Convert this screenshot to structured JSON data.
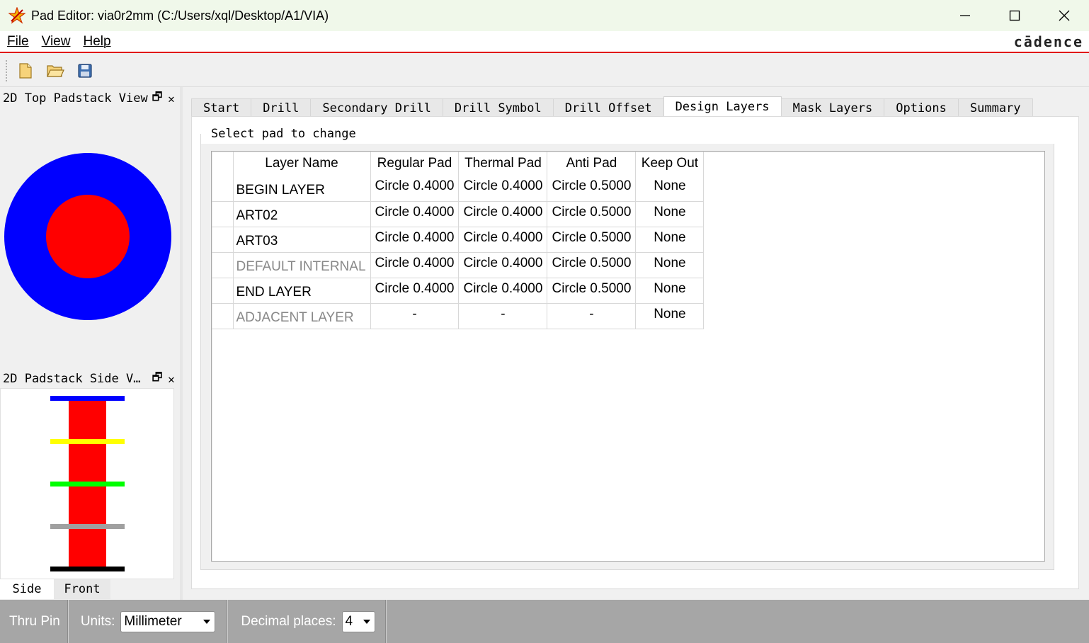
{
  "window": {
    "title": "Pad Editor: via0r2mm  (C:/Users/xql/Desktop/A1/VIA)"
  },
  "menu": {
    "items": [
      "File",
      "View",
      "Help"
    ],
    "brand": "cādence"
  },
  "toolbar": {
    "buttons": [
      "new-file-icon",
      "open-folder-icon",
      "save-icon"
    ]
  },
  "panels": {
    "top_view": {
      "title": "2D Top Padstack View"
    },
    "side_view": {
      "title": "2D Padstack Side V…"
    },
    "side_tabs": [
      "Side",
      "Front"
    ]
  },
  "tabs": [
    "Start",
    "Drill",
    "Secondary Drill",
    "Drill Symbol",
    "Drill Offset",
    "Design Layers",
    "Mask Layers",
    "Options",
    "Summary"
  ],
  "active_tab": "Design Layers",
  "group": {
    "title": "Select pad to change"
  },
  "table": {
    "headers": [
      "Layer Name",
      "Regular Pad",
      "Thermal Pad",
      "Anti Pad",
      "Keep Out"
    ],
    "rows": [
      {
        "name": "BEGIN LAYER",
        "regular": "Circle 0.4000",
        "thermal": "Circle 0.4000",
        "anti": "Circle 0.5000",
        "keepout": "None",
        "disabled": false
      },
      {
        "name": "ART02",
        "regular": "Circle 0.4000",
        "thermal": "Circle 0.4000",
        "anti": "Circle 0.5000",
        "keepout": "None",
        "disabled": false
      },
      {
        "name": "ART03",
        "regular": "Circle 0.4000",
        "thermal": "Circle 0.4000",
        "anti": "Circle 0.5000",
        "keepout": "None",
        "disabled": false
      },
      {
        "name": "DEFAULT INTERNAL",
        "regular": "Circle 0.4000",
        "thermal": "Circle 0.4000",
        "anti": "Circle 0.5000",
        "keepout": "None",
        "disabled": true
      },
      {
        "name": "END LAYER",
        "regular": "Circle 0.4000",
        "thermal": "Circle 0.4000",
        "anti": "Circle 0.5000",
        "keepout": "None",
        "disabled": false
      },
      {
        "name": "ADJACENT LAYER",
        "regular": "-",
        "thermal": "-",
        "anti": "-",
        "keepout": "None",
        "disabled": true
      }
    ]
  },
  "statusbar": {
    "type": "Thru Pin",
    "units_label": "Units:",
    "units_value": "Millimeter",
    "decimal_label": "Decimal places:",
    "decimal_value": "4"
  },
  "colors": {
    "anti_pad": "#0000ff",
    "regular_pad": "#ff0000",
    "side_layers": [
      "#0000ff",
      "#ffff00",
      "#00ff00",
      "#a0a0a0",
      "#000000"
    ]
  }
}
